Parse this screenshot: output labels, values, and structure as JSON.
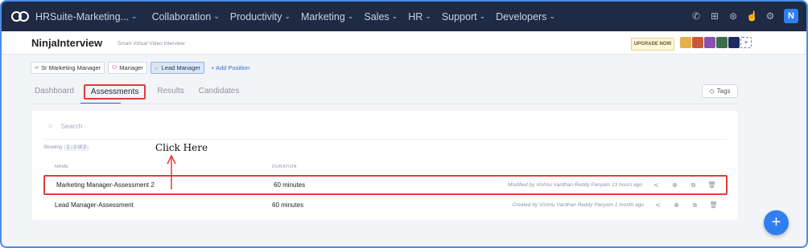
{
  "topnav": {
    "app_name": "HRSuite-Marketing...",
    "items": [
      "Collaboration",
      "Productivity",
      "Marketing",
      "Sales",
      "HR",
      "Support",
      "Developers"
    ],
    "user_initial": "N"
  },
  "appbar": {
    "title": "NinjaInterview",
    "subtitle": "Smart Virtual Video Interview",
    "upgrade_label": "UPGRADE NOW"
  },
  "positions": {
    "items": [
      {
        "label": "Sr Marketing Manager",
        "icon": "infinity-icon",
        "color": "#2aa84a"
      },
      {
        "label": "Manager",
        "icon": "tag-icon",
        "color": "#d02ab0"
      },
      {
        "label": "Lead Manager",
        "icon": "send-icon",
        "color": "#e0a020"
      }
    ],
    "add_label": "+ Add Position"
  },
  "tabs": [
    "Dashboard",
    "Assessments",
    "Results",
    "Candidates"
  ],
  "active_tab": "Assessments",
  "tags_label": "Tags",
  "search": {
    "placeholder": "Search"
  },
  "showing": {
    "label": "Showing",
    "range": "1 - 2 of 2"
  },
  "table": {
    "columns": [
      "NAME",
      "DURATION"
    ],
    "rows": [
      {
        "name": "Marketing Manager-Assessment 2",
        "duration": "60 minutes",
        "meta": "Modified by  Vishnu Vardhan Reddy Panyam  23 hours ago"
      },
      {
        "name": "Lead Manager-Assessment",
        "duration": "60 minutes",
        "meta": "Created by  Vishnu Vardhan Reddy Panyam  1 month ago"
      }
    ]
  },
  "annotation": "Click Here",
  "colors": {
    "nav_bg": "#1f2a44",
    "accent": "#2f7ff0",
    "highlight": "#e33a3a"
  }
}
